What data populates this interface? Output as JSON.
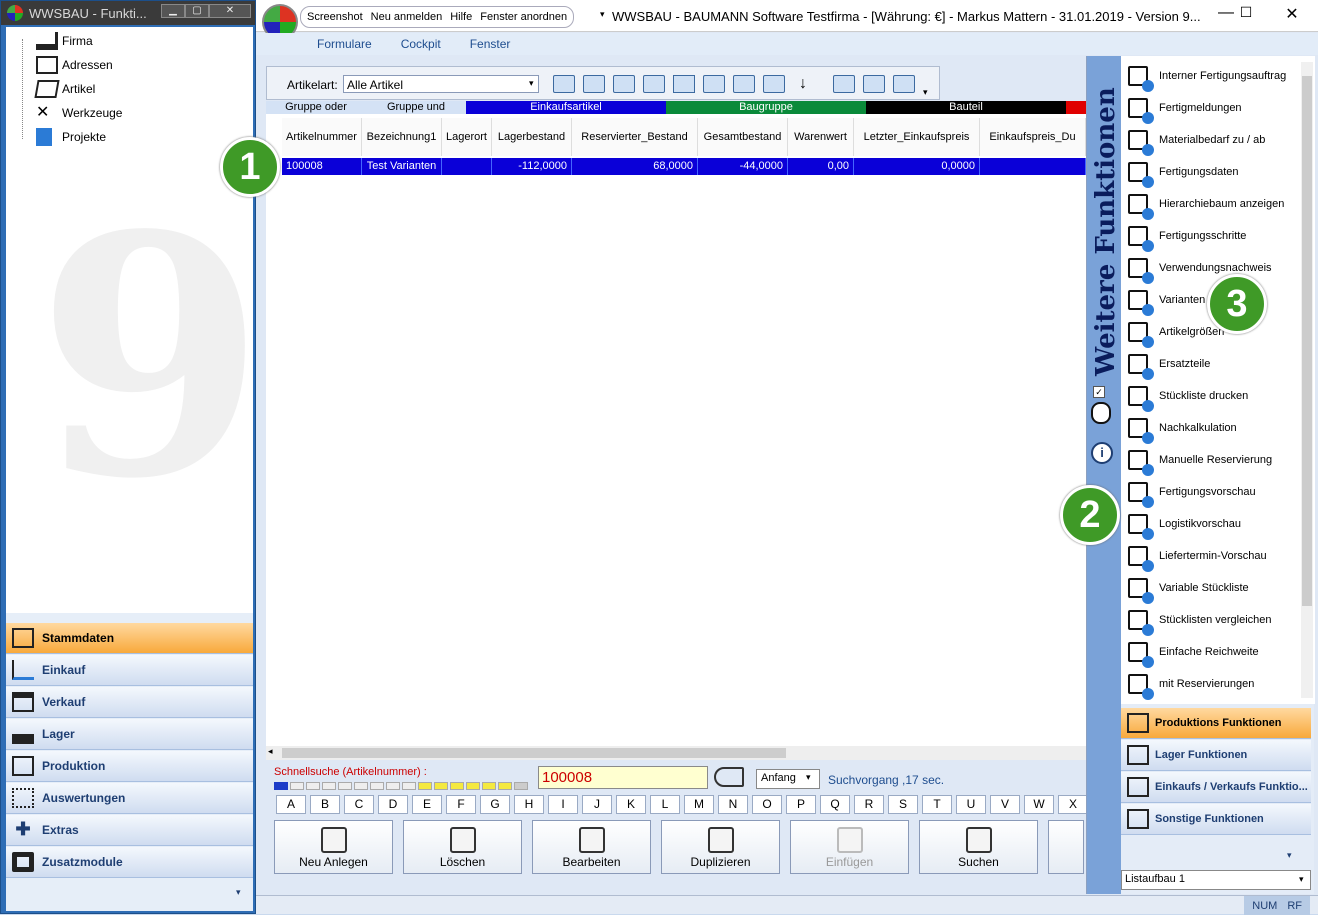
{
  "left_window": {
    "title": "WWSBAU - Funkti...",
    "tree": [
      {
        "label": "Firma",
        "icon": "factory-icon"
      },
      {
        "label": "Adressen",
        "icon": "address-card-icon"
      },
      {
        "label": "Artikel",
        "icon": "box-icon"
      },
      {
        "label": "Werkzeuge",
        "icon": "tools-icon"
      },
      {
        "label": "Projekte",
        "icon": "document-icon"
      }
    ],
    "watermark": "9",
    "nav": [
      {
        "label": "Stammdaten",
        "icon": "database-icon",
        "active": true
      },
      {
        "label": "Einkauf",
        "icon": "cart-icon"
      },
      {
        "label": "Verkauf",
        "icon": "register-icon"
      },
      {
        "label": "Lager",
        "icon": "warehouse-icon"
      },
      {
        "label": "Produktion",
        "icon": "production-icon"
      },
      {
        "label": "Auswertungen",
        "icon": "chart-icon"
      },
      {
        "label": "Extras",
        "icon": "extras-icon"
      },
      {
        "label": "Zusatzmodule",
        "icon": "modules-icon"
      }
    ]
  },
  "main": {
    "quick_access": [
      "Screenshot",
      "Neu anmelden",
      "Hilfe",
      "Fenster anordnen"
    ],
    "title": "WWSBAU - BAUMANN Software Testfirma - [Währung: €] -   Markus Mattern - 31.01.2019 - Version 9...",
    "menu": [
      "Formulare",
      "Cockpit",
      "Fenster"
    ],
    "toolbar": {
      "label": "Artikelart:",
      "value": "Alle Artikel"
    },
    "groups": [
      {
        "label": "Gruppe oder",
        "color": "#d4e2f5",
        "text_color": "#000000"
      },
      {
        "label": "Gruppe und",
        "color": "#d4e2f5",
        "text_color": "#000000"
      },
      {
        "label": "Einkaufsartikel",
        "color": "#0a00d8",
        "text_color": "#ffffff"
      },
      {
        "label": "Baugruppe",
        "color": "#0a8a3a",
        "text_color": "#ffffff"
      },
      {
        "label": "Bauteil",
        "color": "#000000",
        "text_color": "#ffffff"
      },
      {
        "label": "",
        "color": "#e00000",
        "text_color": "#ffffff"
      }
    ],
    "columns": [
      "Artikelnummer",
      "Bezeichnung1",
      "Lagerort",
      "Lagerbestand",
      "Reservierter_Bestand",
      "Gesamtbestand",
      "Warenwert",
      "Letzter_Einkaufspreis",
      "Einkaufspreis_Du"
    ],
    "rows": [
      [
        "100008",
        "Test Varianten",
        "",
        "-112,0000",
        "68,0000",
        "-44,0000",
        "0,00",
        "0,0000",
        ""
      ]
    ],
    "search": {
      "label": "Schnellsuche (Artikelnummer) :",
      "value": "100008",
      "mode": "Anfang",
      "duration": "Suchvorgang ,17 sec."
    },
    "alphabet": [
      "A",
      "B",
      "C",
      "D",
      "E",
      "F",
      "G",
      "H",
      "I",
      "J",
      "K",
      "L",
      "M",
      "N",
      "O",
      "P",
      "Q",
      "R",
      "S",
      "T",
      "U",
      "V",
      "W",
      "X"
    ],
    "buttons": [
      {
        "label": "Neu Anlegen",
        "icon": "new-document-icon"
      },
      {
        "label": "Löschen",
        "icon": "trash-icon"
      },
      {
        "label": "Bearbeiten",
        "icon": "edit-icon"
      },
      {
        "label": "Duplizieren",
        "icon": "duplicate-icon"
      },
      {
        "label": "Einfügen",
        "icon": "paste-icon",
        "disabled": true
      },
      {
        "label": "Suchen",
        "icon": "binoculars-icon"
      }
    ],
    "status": [
      "NUM",
      "RF"
    ]
  },
  "right_panel": {
    "header": "Weitere Funktionen",
    "items": [
      {
        "label": "Interner Fertigungsauftrag",
        "icon": "internal-order-icon"
      },
      {
        "label": "Fertigmeldungen",
        "icon": "completion-icon"
      },
      {
        "label": "Materialbedarf zu / ab",
        "icon": "material-demand-icon"
      },
      {
        "label": "Fertigungsdaten",
        "icon": "production-data-icon"
      },
      {
        "label": "Hierarchiebaum anzeigen",
        "icon": "hierarchy-tree-icon"
      },
      {
        "label": "Fertigungsschritte",
        "icon": "footsteps-icon"
      },
      {
        "label": "Verwendungsnachweis",
        "icon": "usage-icon"
      },
      {
        "label": "Varianten",
        "icon": "variants-icon"
      },
      {
        "label": "Artikelgrößen",
        "icon": "sizes-icon"
      },
      {
        "label": "Ersatzteile",
        "icon": "spare-parts-icon"
      },
      {
        "label": "Stückliste drucken",
        "icon": "print-icon"
      },
      {
        "label": "Nachkalkulation",
        "icon": "calculator-icon"
      },
      {
        "label": "Manuelle Reservierung",
        "icon": "manual-reservation-icon"
      },
      {
        "label": "Fertigungsvorschau",
        "icon": "production-preview-icon"
      },
      {
        "label": "Logistikvorschau",
        "icon": "logistics-preview-icon"
      },
      {
        "label": "Liefertermin-Vorschau",
        "icon": "delivery-preview-icon"
      },
      {
        "label": "Variable Stückliste",
        "icon": "variable-bom-icon"
      },
      {
        "label": "Stücklisten vergleichen",
        "icon": "compare-icon"
      },
      {
        "label": "Einfache Reichweite",
        "icon": "range-icon"
      },
      {
        "label": "mit Reservierungen",
        "icon": "range-reservations-icon"
      }
    ],
    "nav": [
      {
        "label": "Produktions Funktionen",
        "icon": "production-functions-icon",
        "active": true
      },
      {
        "label": "Lager Funktionen",
        "icon": "warehouse-icon"
      },
      {
        "label": "Einkaufs / Verkaufs Funktio...",
        "icon": "cart-icon"
      },
      {
        "label": "Sonstige Funktionen",
        "icon": "other-icon"
      }
    ],
    "combo": "Listaufbau 1"
  },
  "badges": [
    "1",
    "2",
    "3"
  ]
}
